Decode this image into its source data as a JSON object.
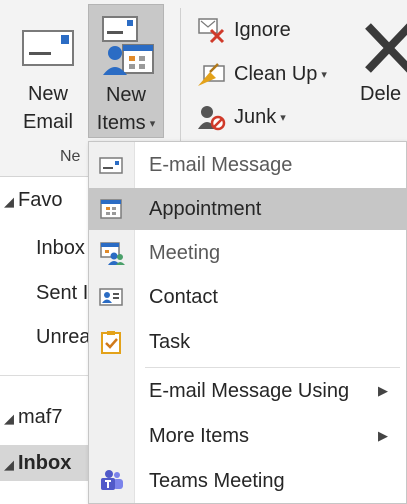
{
  "ribbon": {
    "new_email": {
      "line1": "New",
      "line2": "Email"
    },
    "new_items": {
      "line1": "New",
      "line2": "Items"
    },
    "group_label": "Ne",
    "ignore": "Ignore",
    "clean_up": "Clean Up",
    "junk": "Junk",
    "delete": "Dele",
    "dropdown_caret": "▾"
  },
  "nav": {
    "favorites": "Favo",
    "inbox": "Inbox",
    "sent": "Sent I",
    "unread": "Unrea",
    "account": "maf7",
    "inbox_expanded": "Inbox",
    "collapse_glyph": "◢"
  },
  "menu": {
    "items": [
      {
        "label": "E-mail Message",
        "icon": "email-message-icon"
      },
      {
        "label": "Appointment",
        "icon": "appointment-icon"
      },
      {
        "label": "Meeting",
        "icon": "meeting-icon"
      },
      {
        "label": "Contact",
        "icon": "contact-icon"
      },
      {
        "label": "Task",
        "icon": "task-icon"
      },
      {
        "label": "E-mail Message Using",
        "submenu": true
      },
      {
        "label": "More Items",
        "submenu": true
      },
      {
        "label": "Teams Meeting",
        "icon": "teams-icon"
      }
    ],
    "submenu_arrow": "▶"
  },
  "colors": {
    "accent_blue": "#2b6cc4",
    "selected_bg": "#c6c6c6",
    "ribbon_bg": "#f3f3f3",
    "teams_purple": "#5059c9",
    "task_orange": "#e3a21a"
  }
}
